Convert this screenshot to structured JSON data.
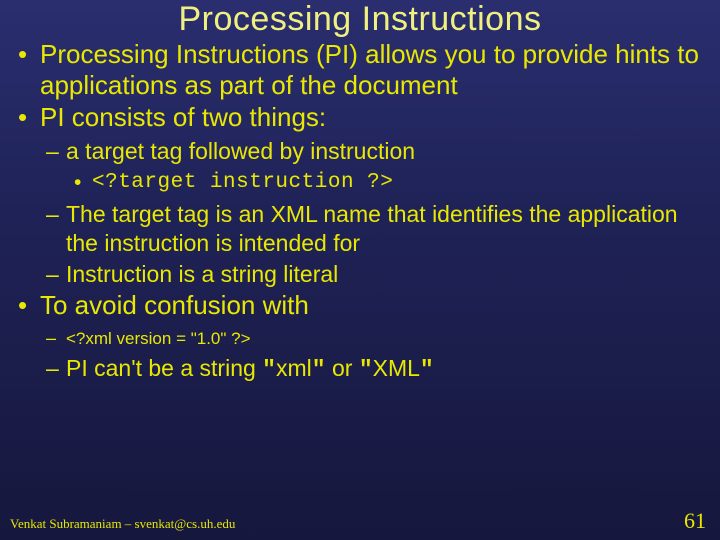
{
  "title": "Processing Instructions",
  "bullets": {
    "b1": "Processing Instructions (PI) allows you to provide hints to applications as part of the document",
    "b2": "PI consists of two things:",
    "b2_sub": {
      "s1": "a target tag followed by instruction",
      "s1_code": "<?target instruction ?>",
      "s2": "The target tag is an XML name that identifies the application the instruction is intended for",
      "s3": "Instruction is a string literal"
    },
    "b3": "To avoid confusion with",
    "b3_sub": {
      "s1": "<?xml version = \"1.0\" ?>",
      "s2_pre": "PI can't be a string ",
      "s2_q1": "\"",
      "s2_x1": "xml",
      "s2_q2": "\"",
      "s2_or": " or ",
      "s2_q3": "\"",
      "s2_x2": "XML",
      "s2_q4": "\""
    }
  },
  "footer": {
    "left": "Venkat Subramaniam – svenkat@cs.uh.edu",
    "page": "61"
  }
}
